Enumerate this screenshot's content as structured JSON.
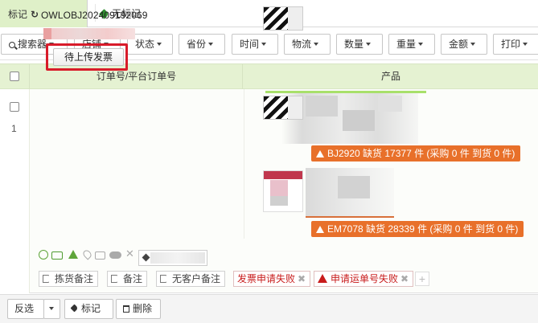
{
  "tagbar": {
    "marked_label": "标记",
    "refresh_icon": "refresh-icon",
    "unmarked_label": "无标记",
    "unmarked_tag_color": "#2e8b2e"
  },
  "filters": [
    {
      "label": "搜索器",
      "icon": "search-icon"
    },
    {
      "label": "店铺"
    },
    {
      "label": "状态"
    },
    {
      "label": "省份"
    },
    {
      "label": "时间"
    },
    {
      "label": "物流"
    },
    {
      "label": "数量"
    },
    {
      "label": "重量"
    },
    {
      "label": "金额"
    },
    {
      "label": "打印"
    }
  ],
  "table": {
    "header_bg": "#e5f2d2",
    "col_order": "订单号/平台订单号",
    "col_product": "产品"
  },
  "order": {
    "index": "1",
    "order_no": "OWLOBJ202409192069",
    "upload_invoice_button": "待上传发票",
    "highlight_color": "#d81b2a",
    "products": [
      {
        "stock_warning": "BJ2920 缺货 17377 件 (采购 0 件 到货 0 件)"
      },
      {
        "stock_warning": "EM7078 缺货 28339 件 (采购 0 件 到货 0 件)"
      }
    ],
    "warning_color": "#e8702a",
    "notes": [
      {
        "label": "拣货备注",
        "icon": "flag-icon"
      },
      {
        "label": "备注",
        "icon": "flag-icon"
      },
      {
        "label": "无客户备注",
        "icon": "flag-icon"
      },
      {
        "label": "发票申请失败",
        "close": "✖"
      },
      {
        "label": "申请运单号失败",
        "icon": "warning-icon",
        "close": "✖"
      }
    ],
    "add_note": "+"
  },
  "footer": {
    "invert_select": "反选",
    "mark": "标记",
    "delete": "删除"
  }
}
